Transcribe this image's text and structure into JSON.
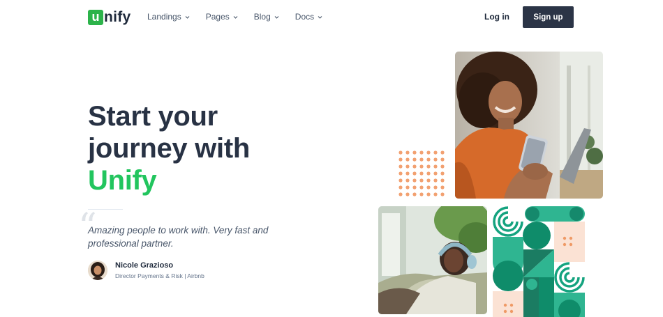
{
  "logo": {
    "mark": "u",
    "text": "nify"
  },
  "nav": {
    "items": [
      {
        "label": "Landings"
      },
      {
        "label": "Pages"
      },
      {
        "label": "Blog"
      },
      {
        "label": "Docs"
      }
    ]
  },
  "auth": {
    "login_label": "Log in",
    "signup_label": "Sign up"
  },
  "hero": {
    "headline_line1": "Start your",
    "headline_line2": "journey with",
    "headline_accent": "Unify",
    "quote": "Amazing people to work with. Very fast and professional partner.",
    "author_name": "Nicole Grazioso",
    "author_role": "Director Payments & Risk | Airbnb"
  },
  "colors": {
    "brand_green": "#22c55e",
    "dark_navy": "#2b3446",
    "teal": "#14a37f",
    "peach": "#f4a06d"
  },
  "icons": [
    "chevron-down-icon",
    "quote-icon"
  ]
}
